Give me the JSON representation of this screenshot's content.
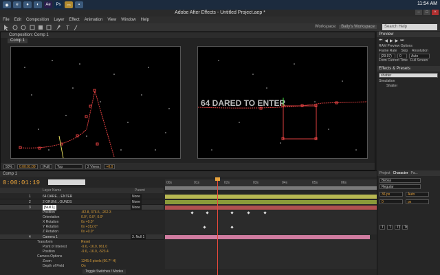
{
  "taskbar": {
    "clock": "11:54 AM",
    "icons": [
      "start-icon",
      "browser-icon",
      "chrome-icon",
      "firefox-icon",
      "ae-icon",
      "ps-icon",
      "folder-icon",
      "app-icon"
    ]
  },
  "window": {
    "title": "Adobe After Effects - Untitled Project.aep *"
  },
  "menu": [
    "File",
    "Edit",
    "Composition",
    "Layer",
    "Effect",
    "Animation",
    "View",
    "Window",
    "Help"
  ],
  "toolbar": {
    "workspace_label": "Workspace:",
    "workspace_value": "Bally's Workspace",
    "search_placeholder": "Search Help"
  },
  "composition": {
    "header": "Composition: Comp 1",
    "tab": "Comp 1",
    "title_text": "64 DARED TO ENTER",
    "footer": {
      "time": "0:00:01:09",
      "resolution": "(Full)",
      "view": "Top",
      "views": "2 Views",
      "exposure": "+0.0"
    }
  },
  "preview": {
    "header": "Preview",
    "ram_options": "RAM Preview Options",
    "frame_rate_label": "Frame Rate",
    "skip_label": "Skip",
    "resolution_label": "Resolution",
    "frame_rate": "(29.97)",
    "skip": "0",
    "resolution": "Auto",
    "from_current": "From Current Time",
    "full_screen": "Full Screen"
  },
  "effects": {
    "header": "Effects & Presets",
    "search_value": "shatter",
    "category": "Simulation",
    "item": "Shatter"
  },
  "timeline": {
    "tab": "Comp 1",
    "time": "0:00:01:19",
    "col_layer": "Layer Name",
    "col_parent": "Parent",
    "ruler": [
      "00s",
      "01s",
      "02s",
      "03s",
      "04s",
      "05s",
      "06s"
    ],
    "layers": [
      {
        "num": "1",
        "name": "64 DARE... ENTER",
        "parent": "None",
        "color": "#c8c85a"
      },
      {
        "num": "2",
        "name": "2 GRUNI...OUNDS",
        "parent": "None",
        "color": "#c8c85a"
      },
      {
        "num": "3",
        "name": "[Null 1]",
        "parent": "None",
        "color": "#c85a5a"
      },
      {
        "num": "4",
        "name": "Camera 1",
        "parent": "3. Null 1",
        "color": "#d07ca0"
      }
    ],
    "props_null": [
      {
        "name": "Position",
        "value": "-82.8, 376.5, -262.3"
      },
      {
        "name": "Orientation",
        "value": "0.0°, 0.0°, 0.0°"
      },
      {
        "name": "X Rotation",
        "value": "0x +0.0°"
      },
      {
        "name": "Y Rotation",
        "value": "0x +312.0°"
      },
      {
        "name": "Z Rotation",
        "value": "0x +0.0°"
      }
    ],
    "camera": {
      "transform": "Transform",
      "reset": "Reset",
      "poi_label": "Point of Interest",
      "poi": "-9.6, -16.0, 961.0",
      "pos_label": "Position",
      "pos": "-9.6, -16.0, -523.4",
      "options": "Camera Options",
      "zoom_label": "Zoom",
      "zoom": "1345.6 pixels (60.7° H)",
      "dof_label": "Depth of Field",
      "dof": "On"
    },
    "toggle": "Toggle Switches / Modes"
  },
  "character": {
    "tabs": [
      "Project",
      "Character",
      "Pa..."
    ],
    "font": "Bebas",
    "style": "Regular",
    "size": "36 px",
    "tracking": "Auto",
    "kerning": "0",
    "leading": "px"
  }
}
